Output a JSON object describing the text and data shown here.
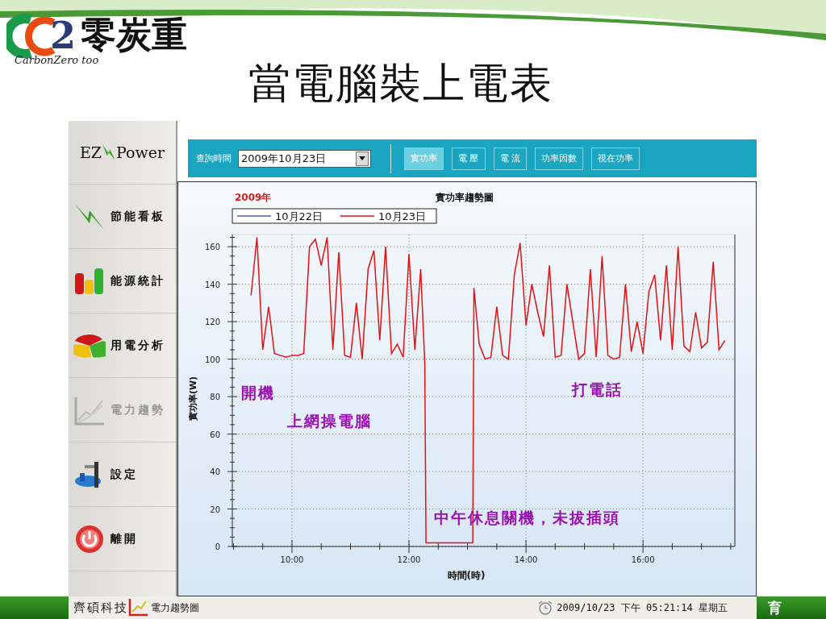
{
  "logo": {
    "mark": "2",
    "name": "零炭重",
    "tagline": "CarbonZero too"
  },
  "slide_title": "當電腦裝上電表",
  "app": {
    "brand": {
      "left": "EZ",
      "right": "Power"
    },
    "sidebar": {
      "items": [
        {
          "label": "節能看板",
          "kind": "bolt",
          "selected": false
        },
        {
          "label": "能源統計",
          "kind": "bars",
          "selected": false
        },
        {
          "label": "用電分析",
          "kind": "pie",
          "selected": false
        },
        {
          "label": "電力趨勢",
          "kind": "trend",
          "selected": true
        },
        {
          "label": "設定",
          "kind": "tools",
          "selected": false
        },
        {
          "label": "離開",
          "kind": "power",
          "selected": false
        }
      ]
    },
    "toolbar": {
      "query_label": "查詢時間",
      "date_value": "2009年10月23日",
      "buttons": [
        {
          "label": "實功率",
          "selected": true
        },
        {
          "label": "電 壓",
          "selected": false
        },
        {
          "label": "電 流",
          "selected": false
        },
        {
          "label": "功率因數",
          "selected": false
        },
        {
          "label": "視在功率",
          "selected": false
        }
      ]
    },
    "chart": {
      "year": "2009年",
      "chart_data": {
        "type": "line",
        "title": "實功率趨勢圖",
        "xlabel": "時間(時)",
        "ylabel": "實功率(W)",
        "x": [
          9.3,
          9.4,
          9.5,
          9.6,
          9.7,
          9.8,
          9.9,
          10,
          10.1,
          10.2,
          10.3,
          10.4,
          10.5,
          10.6,
          10.7,
          10.8,
          10.9,
          11,
          11.1,
          11.2,
          11.3,
          11.4,
          11.5,
          11.6,
          11.7,
          11.8,
          11.9,
          12,
          12.1,
          12.2,
          12.27,
          12.29,
          12.5,
          12.6,
          12.7,
          12.8,
          12.9,
          13.09,
          13.11,
          13.2,
          13.3,
          13.4,
          13.5,
          13.6,
          13.7,
          13.8,
          13.9,
          14,
          14.1,
          14.2,
          14.3,
          14.4,
          14.5,
          14.6,
          14.7,
          14.8,
          14.9,
          15,
          15.1,
          15.2,
          15.3,
          15.4,
          15.5,
          15.6,
          15.7,
          15.8,
          15.9,
          16,
          16.1,
          16.2,
          16.3,
          16.4,
          16.5,
          16.6,
          16.7,
          16.8,
          16.9,
          17,
          17.1,
          17.2,
          17.3,
          17.4
        ],
        "series": [
          {
            "name": "10月22日",
            "color": "#4a5fc0",
            "values": [
              null,
              null,
              null,
              null,
              null,
              null,
              null,
              null,
              null,
              null,
              null,
              null,
              null,
              null,
              null,
              null,
              null,
              null,
              null,
              null,
              null,
              null,
              null,
              null,
              null,
              null,
              null,
              null,
              null,
              null,
              null,
              null,
              null,
              null,
              null,
              null,
              null,
              null,
              null,
              null,
              null,
              null,
              null,
              null,
              null,
              null,
              null,
              null,
              null,
              null,
              null,
              null,
              null,
              null,
              null,
              null,
              null,
              null,
              null,
              null,
              null,
              null,
              null,
              null,
              null,
              null,
              null,
              null,
              null,
              null,
              null,
              null,
              null,
              null,
              null,
              null,
              null,
              null,
              null,
              null,
              null,
              null
            ]
          },
          {
            "name": "10月23日",
            "color": "#e81010",
            "values": [
              134,
              165,
              105,
              128,
              103,
              102,
              101,
              102,
              102,
              103,
              160,
              164,
              150,
              165,
              105,
              157,
              102,
              101,
              130,
              100,
              148,
              158,
              110,
              160,
              103,
              108,
              101,
              156,
              105,
              148,
              98,
              2,
              2,
              2,
              2,
              2,
              2,
              2,
              138,
              108,
              100,
              101,
              128,
              102,
              100,
              145,
              162,
              118,
              140,
              125,
              112,
              150,
              101,
              102,
              140,
              120,
              100,
              103,
              148,
              101,
              155,
              102,
              100,
              101,
              140,
              104,
              120,
              103,
              136,
              145,
              110,
              150,
              105,
              160,
              107,
              104,
              125,
              106,
              109,
              152,
              105,
              110
            ]
          }
        ],
        "xlim": [
          8.98,
          17.57
        ],
        "ylim": [
          0,
          166.5
        ],
        "xticks": [
          {
            "value": 10,
            "label": "10:00"
          },
          {
            "value": 12,
            "label": "12:00"
          },
          {
            "value": 14,
            "label": "14:00"
          },
          {
            "value": 16,
            "label": "16:00"
          }
        ],
        "yticks": [
          0,
          20,
          40,
          60,
          80,
          100,
          120,
          140,
          160
        ],
        "grid": true,
        "annotations": [
          "開機",
          "上網操電腦",
          "打電話",
          "中午休息關機，未拔插頭"
        ]
      }
    },
    "status_bar": {
      "company": "齊碩科技",
      "view": "電力趨勢圖",
      "clock": "2009/10/23 下午 05:21:14 星期五"
    }
  },
  "footer_text": "育"
}
